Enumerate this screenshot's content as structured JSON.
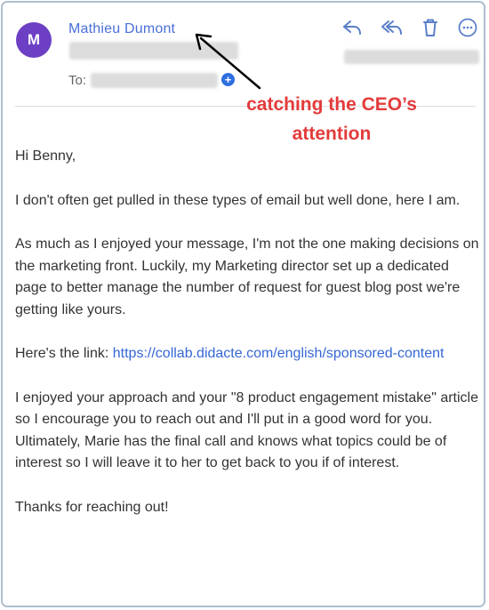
{
  "email": {
    "avatar_initial": "M",
    "sender_name": "Mathieu Dumont",
    "to_label": "To:",
    "greeting": "Hi Benny,",
    "para1": "I don't often get pulled in these types of email but well done, here I am.",
    "para2": "As much as I enjoyed your message, I'm not the one making decisions on the marketing front. Luckily, my Marketing director set up a dedicated page to better manage the number of request for guest blog post we're getting like yours.",
    "link_prefix": "Here's the link: ",
    "link_url": "https://collab.didacte.com/english/sponsored-content",
    "para4": "I enjoyed your approach and your \"8 product engagement mistake\" article so I encourage you to reach out and I'll put in a good word for you. Ultimately, Marie has the final call and knows what topics could be of interest so I will leave it to her to get back to you if of interest.",
    "closing": "Thanks for reaching out!"
  },
  "annotation": {
    "text": "catching the CEO’s attention",
    "color": "#e33b3b"
  },
  "colors": {
    "avatar": "#6c3fc4",
    "sender": "#4a6fd8",
    "link": "#3567d6",
    "icons": "#5b7fc9"
  },
  "toolbar_icons": [
    "reply-icon",
    "reply-all-icon",
    "trash-icon",
    "more-icon"
  ]
}
